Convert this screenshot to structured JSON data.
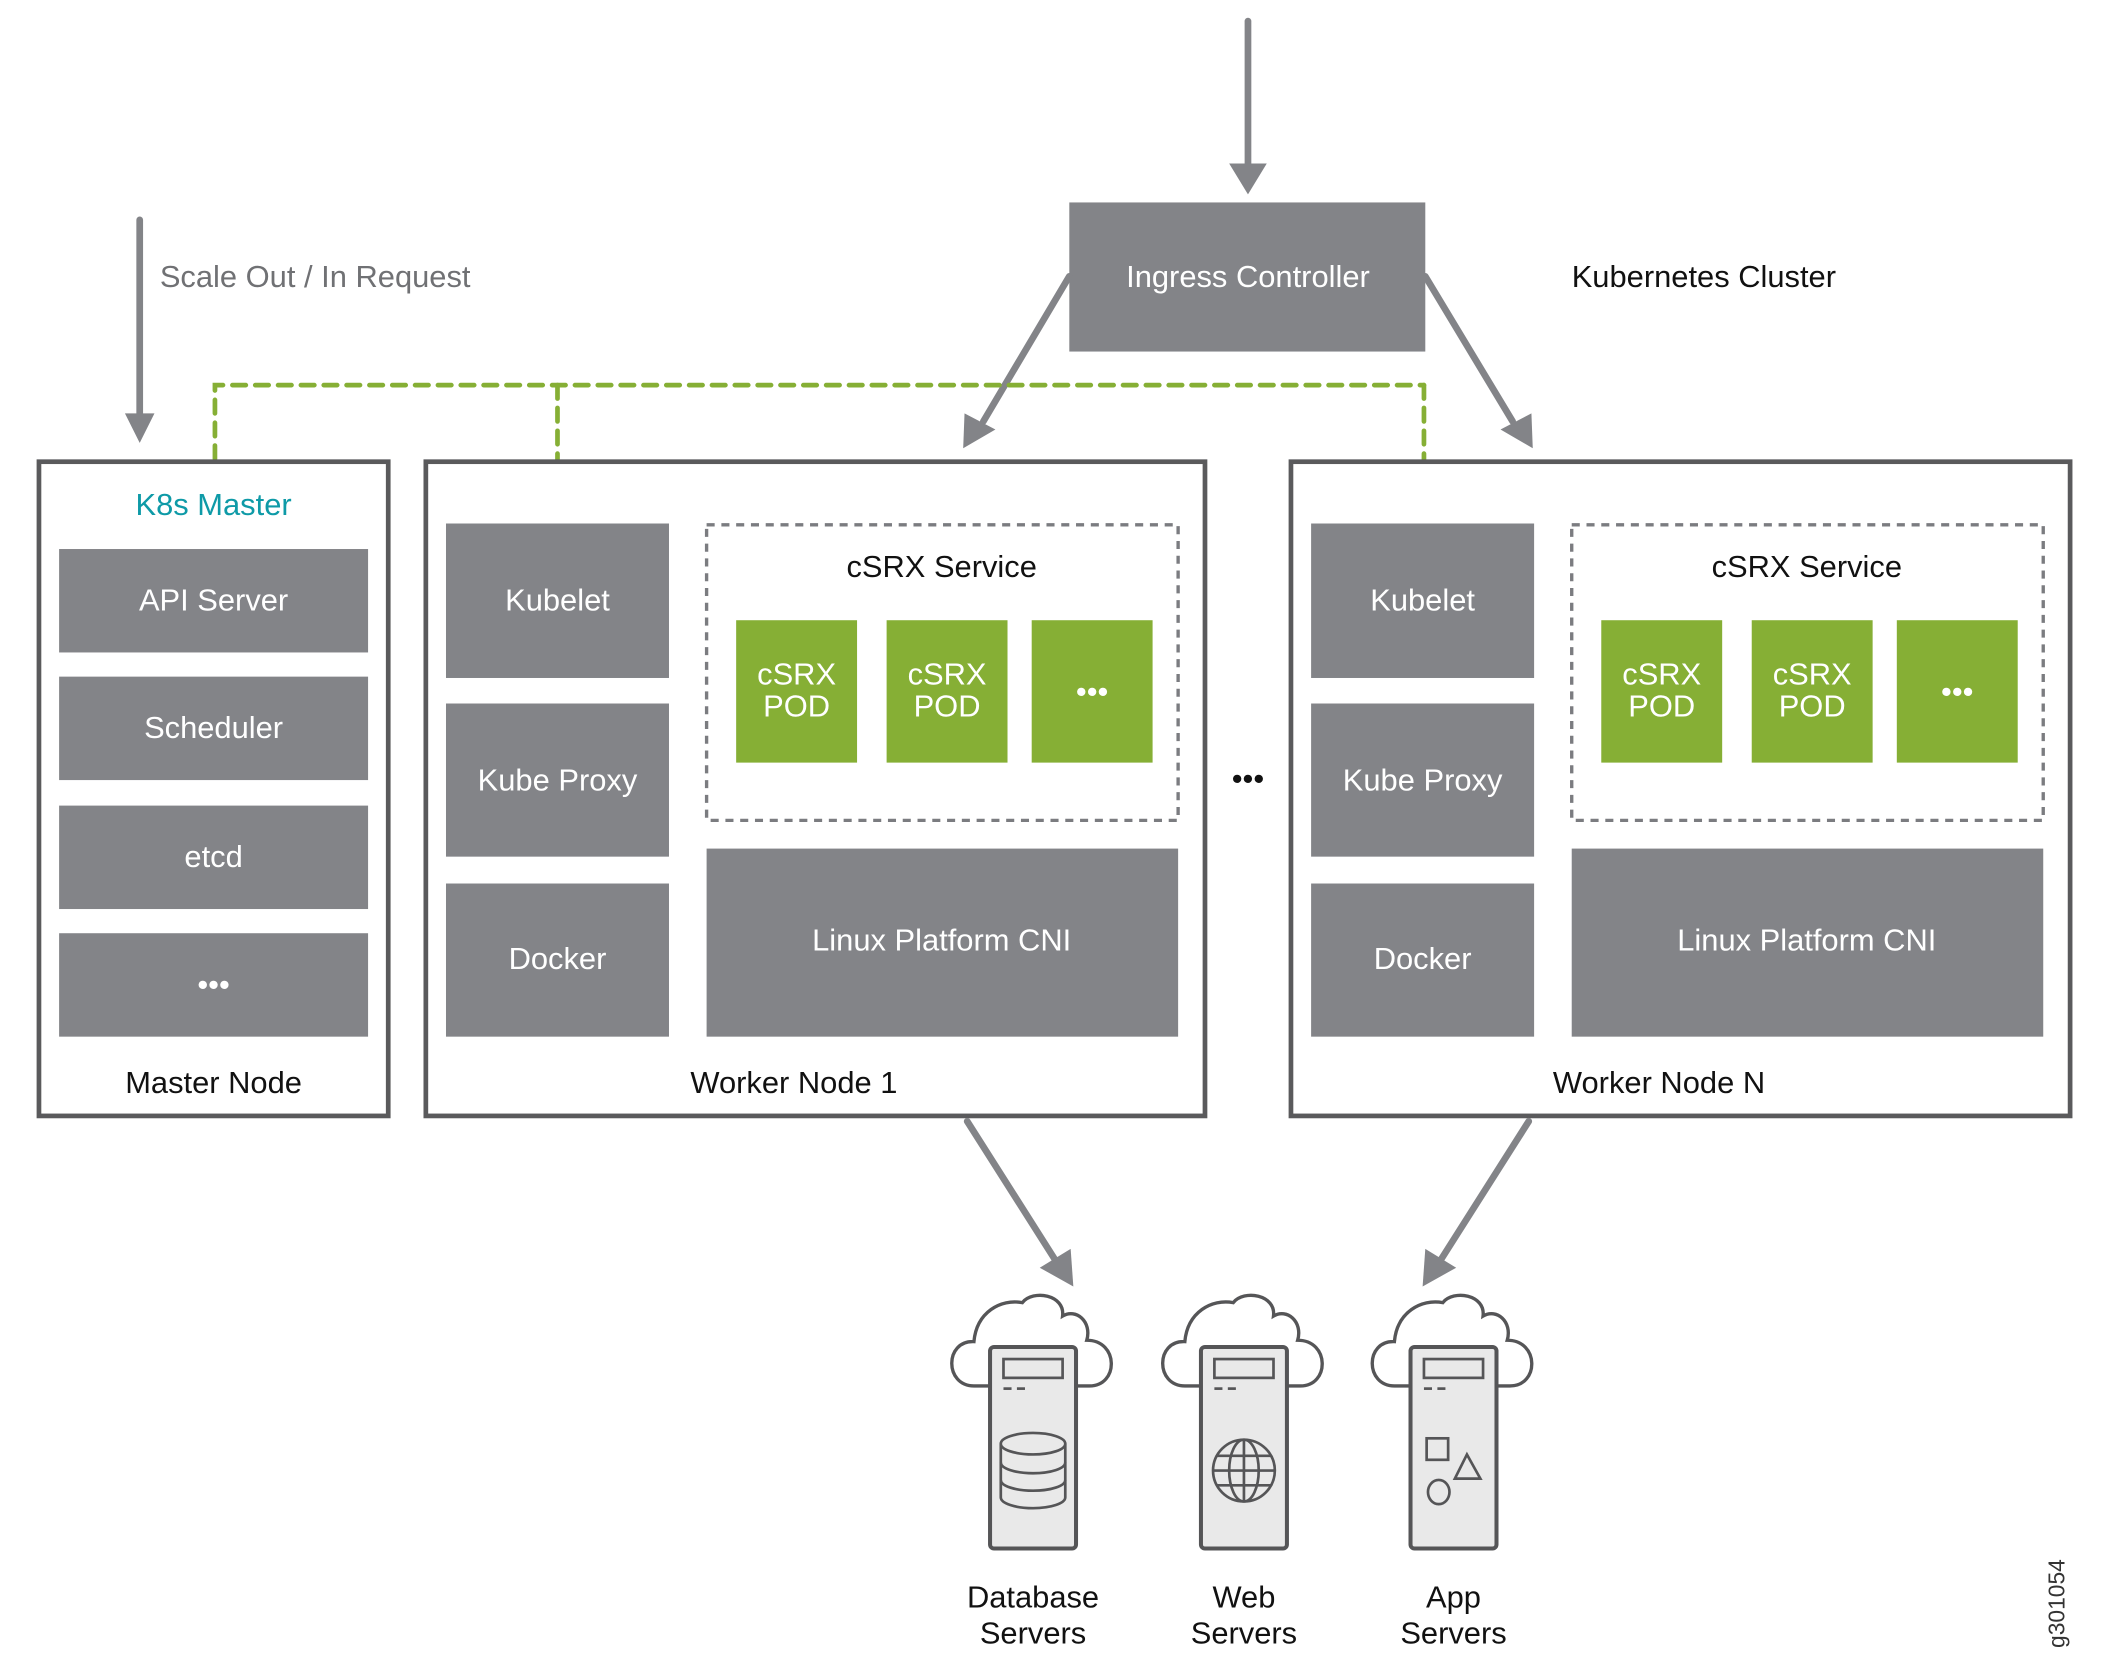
{
  "diagram": {
    "cluster_label": "Kubernetes Cluster",
    "figure_id": "g301054",
    "colors": {
      "component_gray": "#838488",
      "pod_green": "#86af35",
      "master_title_teal": "#0e9aa7",
      "frame_dark": "#5a5a5c",
      "control_link_green": "#86af35"
    },
    "scale_request": {
      "label": "Scale Out / In Request",
      "icon": "arrow-down-icon"
    },
    "ingress": {
      "label": "Ingress Controller",
      "inbound_icon": "arrow-down-icon"
    },
    "master_node": {
      "title": "K8s Master",
      "footer": "Master Node",
      "components": [
        "API Server",
        "Scheduler",
        "etcd",
        "•••"
      ]
    },
    "worker_nodes": [
      {
        "footer": "Worker Node 1",
        "components": [
          "Kubelet",
          "Kube Proxy",
          "Docker"
        ],
        "service": {
          "title": "cSRX Service",
          "pods": [
            {
              "line1": "cSRX",
              "line2": "POD"
            },
            {
              "line1": "cSRX",
              "line2": "POD"
            },
            {
              "line1": "•••",
              "line2": ""
            }
          ]
        },
        "platform": "Linux Platform CNI"
      },
      {
        "footer": "Worker Node N",
        "components": [
          "Kubelet",
          "Kube Proxy",
          "Docker"
        ],
        "service": {
          "title": "cSRX Service",
          "pods": [
            {
              "line1": "cSRX",
              "line2": "POD"
            },
            {
              "line1": "cSRX",
              "line2": "POD"
            },
            {
              "line1": "•••",
              "line2": ""
            }
          ]
        },
        "platform": "Linux Platform CNI"
      }
    ],
    "between_workers": "•••",
    "servers": [
      {
        "line1": "Database",
        "line2": "Servers",
        "icon": "database-icon"
      },
      {
        "line1": "Web",
        "line2": "Servers",
        "icon": "globe-icon"
      },
      {
        "line1": "App",
        "line2": "Servers",
        "icon": "shapes-icon"
      }
    ]
  }
}
